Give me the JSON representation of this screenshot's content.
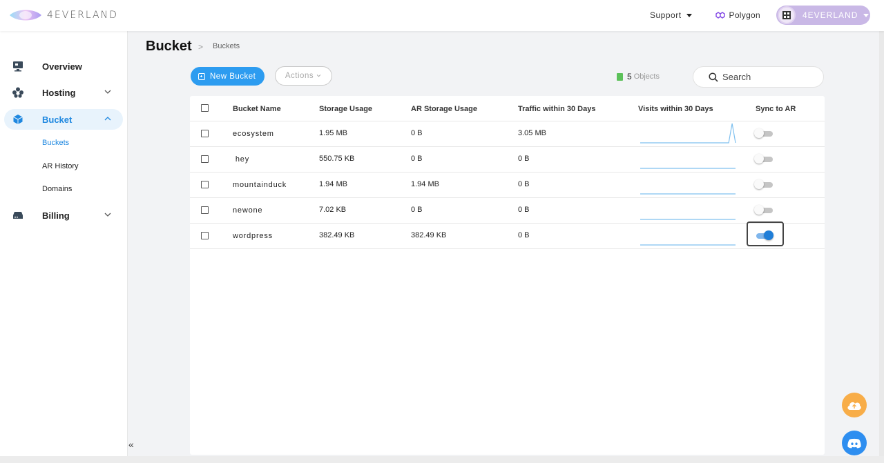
{
  "app": {
    "brand": "4EVERLAND"
  },
  "header": {
    "support_label": "Support",
    "network_label": "Polygon",
    "user_name": "4EVERLAND"
  },
  "sidebar": {
    "items": [
      {
        "label": "Overview",
        "icon": "monitor-icon"
      },
      {
        "label": "Hosting",
        "icon": "hosting-icon"
      },
      {
        "label": "Bucket",
        "icon": "cube-icon",
        "active": true,
        "children": [
          {
            "label": "Buckets",
            "active": true
          },
          {
            "label": "AR History"
          },
          {
            "label": "Domains"
          }
        ]
      },
      {
        "label": "Billing",
        "icon": "billing-icon"
      }
    ],
    "collapse_glyph": "«"
  },
  "page": {
    "title": "Bucket",
    "breadcrumb_sep": ">",
    "breadcrumb": "Buckets"
  },
  "toolbar": {
    "new_bucket_label": "New Bucket",
    "actions_label": "Actions",
    "objects_count": "5",
    "objects_label": "Objects",
    "search_placeholder": "Search"
  },
  "table": {
    "columns": [
      "Bucket Name",
      "Storage Usage",
      "AR Storage Usage",
      "Traffic within 30 Days",
      "Visits within 30 Days",
      "Sync to AR"
    ],
    "rows": [
      {
        "name": "ecosystem",
        "storage": "1.95 MB",
        "ar_storage": "0 B",
        "traffic": "3.05 MB",
        "visits": [
          0,
          0,
          0,
          0,
          0,
          0,
          0,
          0,
          0,
          0,
          0,
          0,
          0,
          0,
          0,
          0,
          0,
          0,
          0,
          0,
          0,
          0,
          0,
          0,
          0,
          0,
          0,
          1,
          0
        ],
        "sync": false
      },
      {
        "name": " hey",
        "storage": "550.75 KB",
        "ar_storage": "0 B",
        "traffic": "0 B",
        "visits": [
          0,
          0,
          0,
          0,
          0,
          0,
          0,
          0,
          0,
          0,
          0,
          0,
          0,
          0,
          0,
          0,
          0,
          0,
          0,
          0,
          0,
          0,
          0,
          0,
          0,
          0,
          0,
          0,
          0
        ],
        "sync": false
      },
      {
        "name": "mountainduck",
        "storage": "1.94 MB",
        "ar_storage": "1.94 MB",
        "traffic": "0 B",
        "visits": [
          0,
          0,
          0,
          0,
          0,
          0,
          0,
          0,
          0,
          0,
          0,
          0,
          0,
          0,
          0,
          0,
          0,
          0,
          0,
          0,
          0,
          0,
          0,
          0,
          0,
          0,
          0,
          0,
          0
        ],
        "sync": false
      },
      {
        "name": "newone",
        "storage": "7.02 KB",
        "ar_storage": "0 B",
        "traffic": "0 B",
        "visits": [
          0,
          0,
          0,
          0,
          0,
          0,
          0,
          0,
          0,
          0,
          0,
          0,
          0,
          0,
          0,
          0,
          0,
          0,
          0,
          0,
          0,
          0,
          0,
          0,
          0,
          0,
          0,
          0,
          0
        ],
        "sync": false
      },
      {
        "name": "wordpress",
        "storage": "382.49 KB",
        "ar_storage": "382.49 KB",
        "traffic": "0 B",
        "visits": [
          0,
          0,
          0,
          0,
          0,
          0,
          0,
          0,
          0,
          0,
          0,
          0,
          0,
          0,
          0,
          0,
          0,
          0,
          0,
          0,
          0,
          0,
          0,
          0,
          0,
          0,
          0,
          0,
          0
        ],
        "sync": true,
        "focused": true
      }
    ]
  },
  "colors": {
    "accent": "#2d9cf0",
    "link": "#1f7bc4",
    "sparkline": "#7fc0ef",
    "upload_fab": "#f8ad48",
    "discord_fab": "#2e8ef0"
  }
}
